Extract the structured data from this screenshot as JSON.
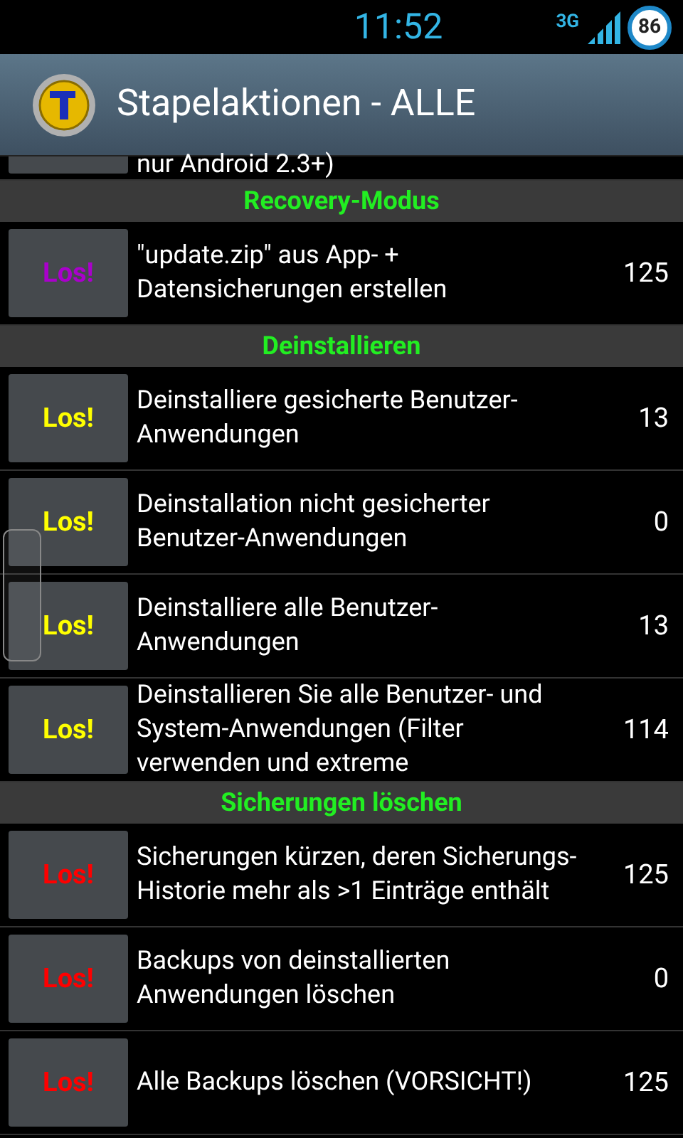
{
  "status_bar": {
    "time": "11:52",
    "network": "3G",
    "battery": "86"
  },
  "action_bar": {
    "title": "Stapelaktionen - ALLE"
  },
  "partial_row": {
    "text": "nur Android 2.3+)"
  },
  "sections": [
    {
      "title": "Recovery-Modus",
      "rows": [
        {
          "button": "Los!",
          "color": "#aa00cc",
          "text": "\"update.zip\" aus App- + Datensicherungen erstellen",
          "count": "125"
        }
      ]
    },
    {
      "title": "Deinstallieren",
      "rows": [
        {
          "button": "Los!",
          "color": "#ffff00",
          "text": "Deinstalliere gesicherte Benutzer-Anwendungen",
          "count": "13"
        },
        {
          "button": "Los!",
          "color": "#ffff00",
          "text": "Deinstallation nicht gesicherter Benutzer-Anwendungen",
          "count": "0"
        },
        {
          "button": "Los!",
          "color": "#ffff00",
          "text": "Deinstalliere alle Benutzer-Anwendungen",
          "count": "13"
        },
        {
          "button": "Los!",
          "color": "#ffff00",
          "text": "Deinstallieren Sie alle Benutzer- und System-Anwendungen (Filter verwenden und extreme",
          "count": "114"
        }
      ]
    },
    {
      "title": "Sicherungen löschen",
      "rows": [
        {
          "button": "Los!",
          "color": "#ff0000",
          "text": "Sicherungen kürzen, deren Sicherungs-Historie mehr als >1 Einträge enthält",
          "count": "125"
        },
        {
          "button": "Los!",
          "color": "#ff0000",
          "text": "Backups von deinstallierten Anwendungen löschen",
          "count": "0"
        },
        {
          "button": "Los!",
          "color": "#ff0000",
          "text": "Alle Backups löschen (VORSICHT!)",
          "count": "125"
        }
      ]
    }
  ]
}
